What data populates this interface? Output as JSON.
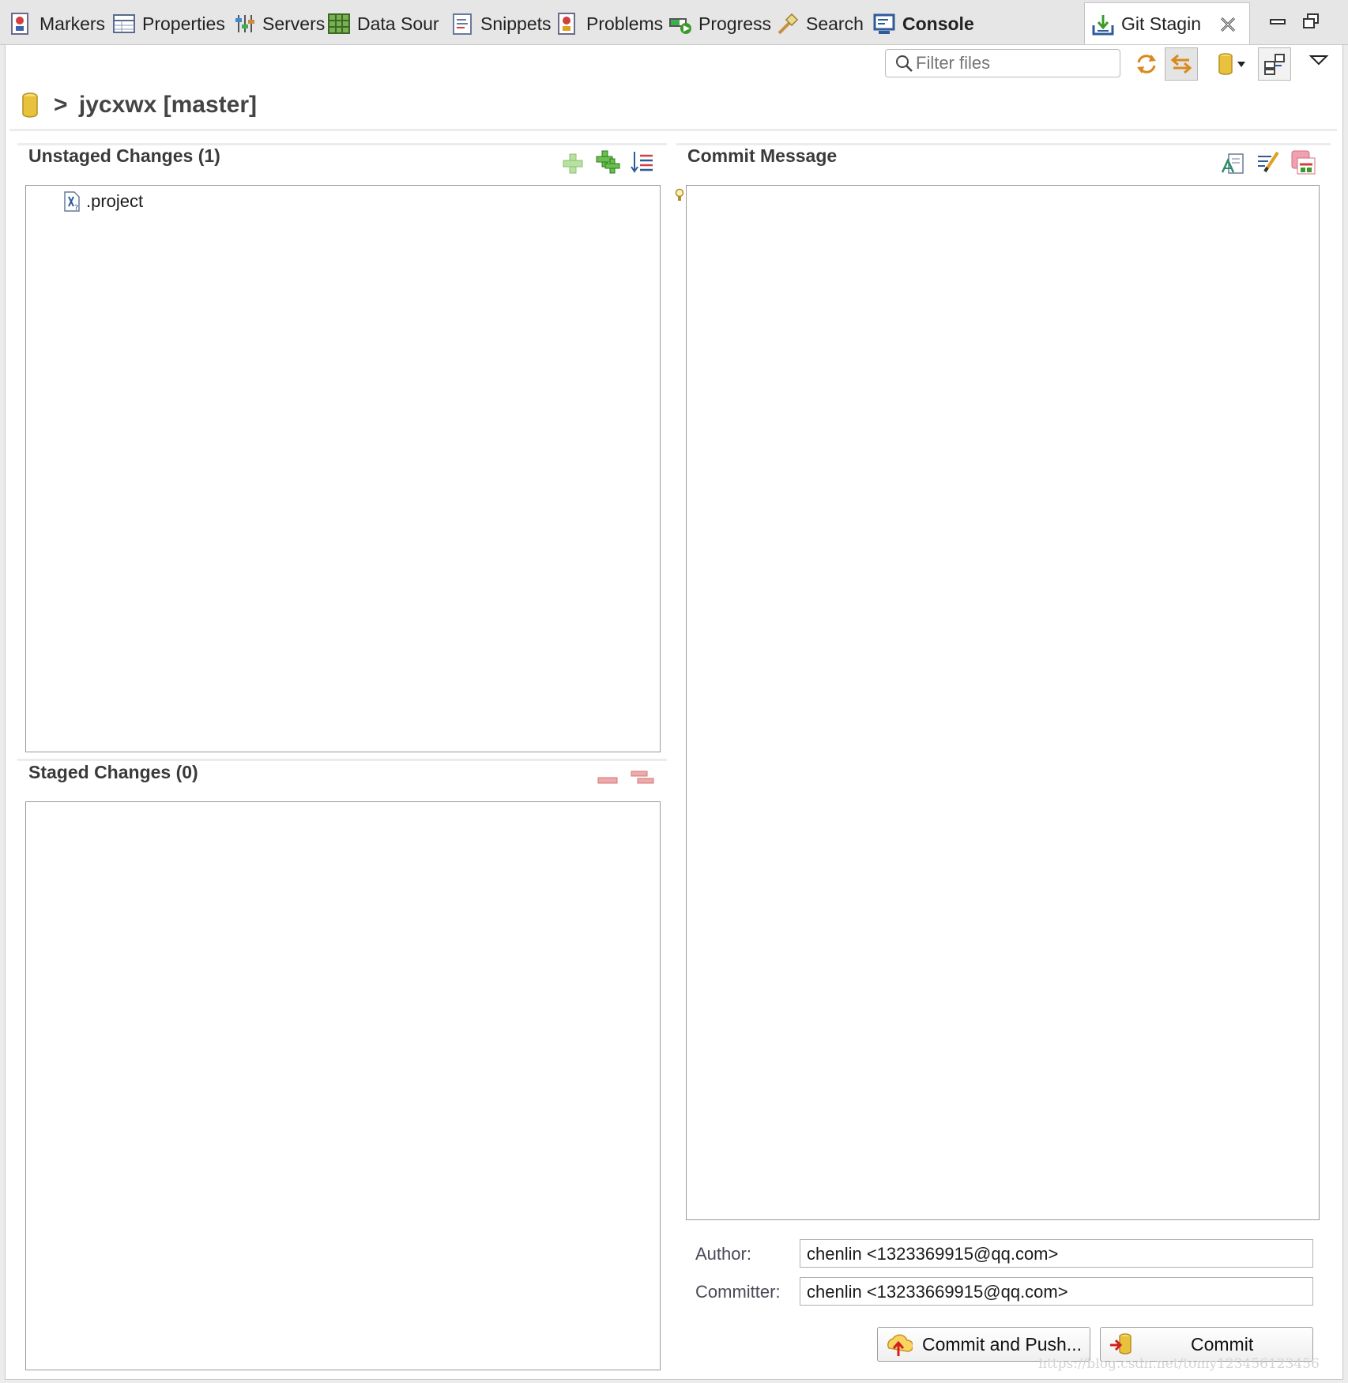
{
  "tabs": [
    {
      "label": "Markers",
      "icon": "markers-icon"
    },
    {
      "label": "Properties",
      "icon": "properties-icon"
    },
    {
      "label": "Servers",
      "icon": "servers-icon"
    },
    {
      "label": "Data Sour",
      "icon": "data-source-icon"
    },
    {
      "label": "Snippets",
      "icon": "snippets-icon"
    },
    {
      "label": "Problems",
      "icon": "problems-icon"
    },
    {
      "label": "Progress",
      "icon": "progress-icon"
    },
    {
      "label": "Search",
      "icon": "search-tool-icon"
    },
    {
      "label": "Console",
      "icon": "console-icon"
    },
    {
      "label": "Git Stagin",
      "icon": "git-staging-icon"
    }
  ],
  "toolbar": {
    "filter_placeholder": "Filter files"
  },
  "repo": {
    "arrow": ">",
    "name": "jycxwx [master]"
  },
  "unstaged": {
    "title": "Unstaged Changes (1)",
    "files": [
      ".project"
    ]
  },
  "staged": {
    "title": "Staged Changes (0)",
    "files": []
  },
  "commit": {
    "title": "Commit Message",
    "message": "",
    "author_label": "Author:",
    "author_value": "chenlin <1323369915@qq.com>",
    "committer_label": "Committer:",
    "committer_value": "chenlin <13233669915@qq.com>",
    "commit_and_push_label": "Commit and Push...",
    "commit_label": "Commit"
  },
  "watermark": "https://blog.csdn.net/tomy123456123456",
  "colors": {
    "accent_blue": "#2d5b9a",
    "git_gold": "#e8c23c",
    "add_green": "#3c9a2c",
    "remove_red": "#e07878"
  }
}
